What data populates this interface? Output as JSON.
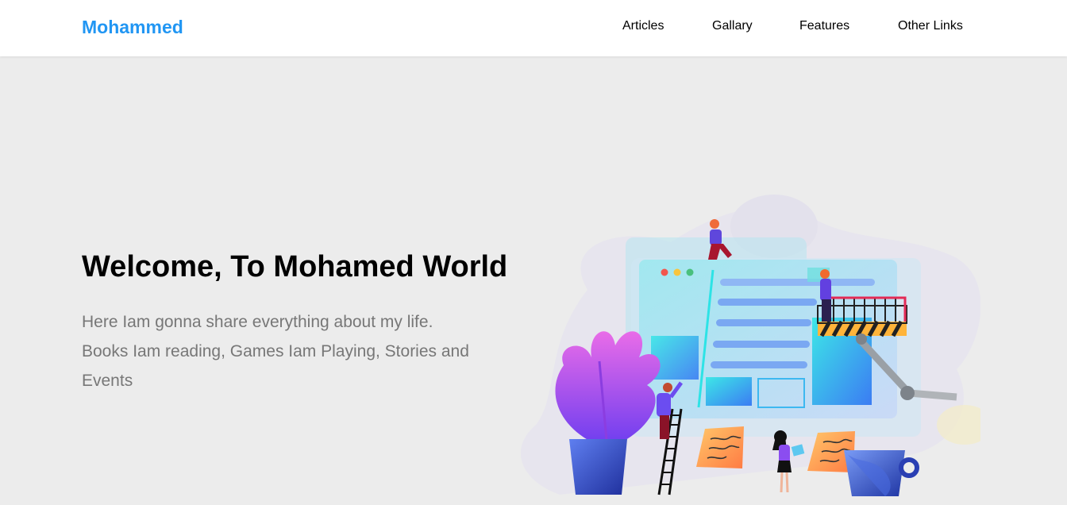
{
  "header": {
    "logo": "Mohammed",
    "nav": [
      {
        "label": "Articles"
      },
      {
        "label": "Gallary"
      },
      {
        "label": "Features"
      },
      {
        "label": "Other Links"
      }
    ]
  },
  "hero": {
    "title": "Welcome, To Mohamed World",
    "text": "Here Iam gonna share everything about my life. Books Iam reading, Games Iam Playing, Stories and Events"
  },
  "colors": {
    "accent": "#2196f3",
    "background": "#ececec",
    "body_text": "#777777"
  }
}
